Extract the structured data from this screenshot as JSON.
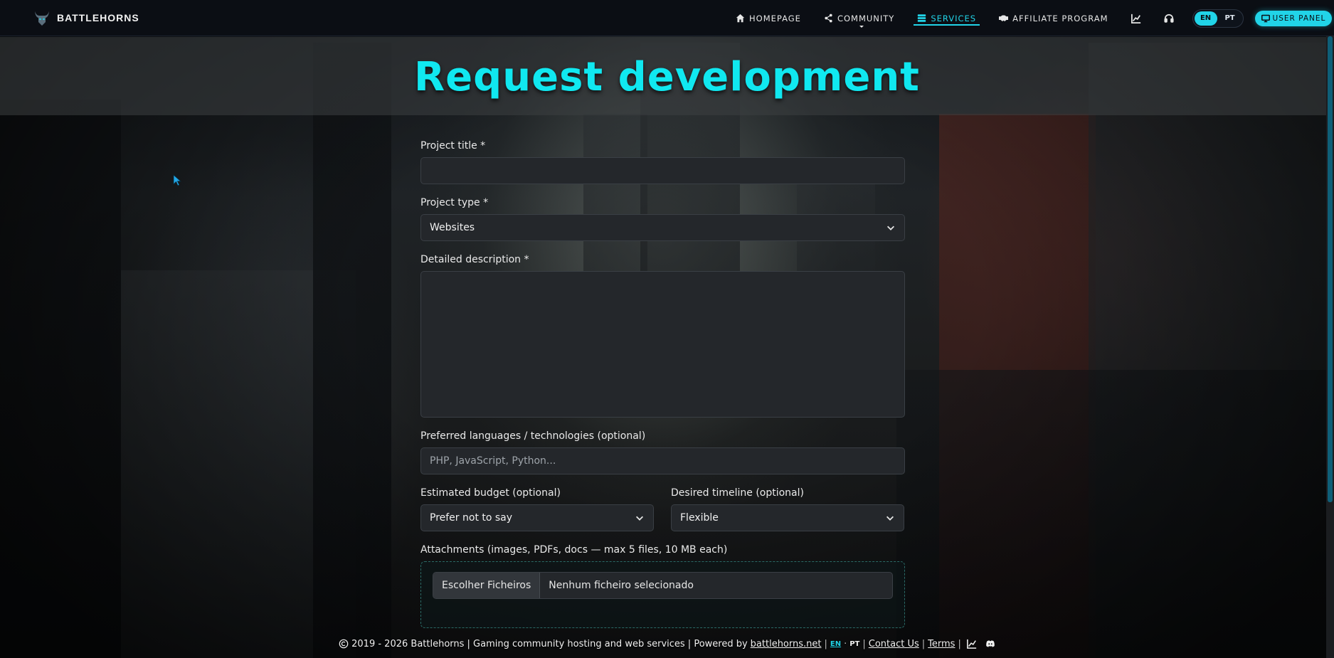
{
  "brand": {
    "name": "BATTLEHORNS",
    "logo_icon": "bull-logo-icon"
  },
  "nav": {
    "items": [
      {
        "label": "HOMEPAGE",
        "icon": "home-icon",
        "active": false
      },
      {
        "label": "COMMUNITY",
        "icon": "share-icon",
        "active": false
      },
      {
        "label": "SERVICES",
        "icon": "server-icon",
        "active": true
      },
      {
        "label": "AFFILIATE PROGRAM",
        "icon": "handshake-icon",
        "active": false
      }
    ],
    "stats_icon": "chart-line-icon",
    "support_icon": "headset-icon",
    "languages": [
      "EN",
      "PT"
    ],
    "active_language": "EN",
    "user_panel_label": "USER PANEL"
  },
  "page": {
    "title": "Request development"
  },
  "form": {
    "project_title": {
      "label": "Project title *",
      "value": ""
    },
    "project_type": {
      "label": "Project type *",
      "value": "Websites"
    },
    "description": {
      "label": "Detailed description *",
      "value": ""
    },
    "technologies": {
      "label": "Preferred languages / technologies (optional)",
      "placeholder": "PHP, JavaScript, Python..."
    },
    "budget": {
      "label": "Estimated budget (optional)",
      "value": "Prefer not to say"
    },
    "timeline": {
      "label": "Desired timeline (optional)",
      "value": "Flexible"
    },
    "attachments": {
      "label": "Attachments (images, PDFs, docs — max 5 files, 10 MB each)",
      "button_label": "Escolher Ficheiros",
      "status": "Nenhum ficheiro selecionado"
    }
  },
  "footer": {
    "copyright": "2019 - 2026 Battlehorns | Gaming community hosting and web services | Powered by",
    "powered_link": "battlehorns.net",
    "lang_en": "EN",
    "lang_pt": "PT",
    "contact": "Contact Us",
    "terms": "Terms"
  },
  "colors": {
    "accent": "#21d4e8",
    "title": "#10e8f0",
    "navbar_bg": "#0b0e14"
  }
}
